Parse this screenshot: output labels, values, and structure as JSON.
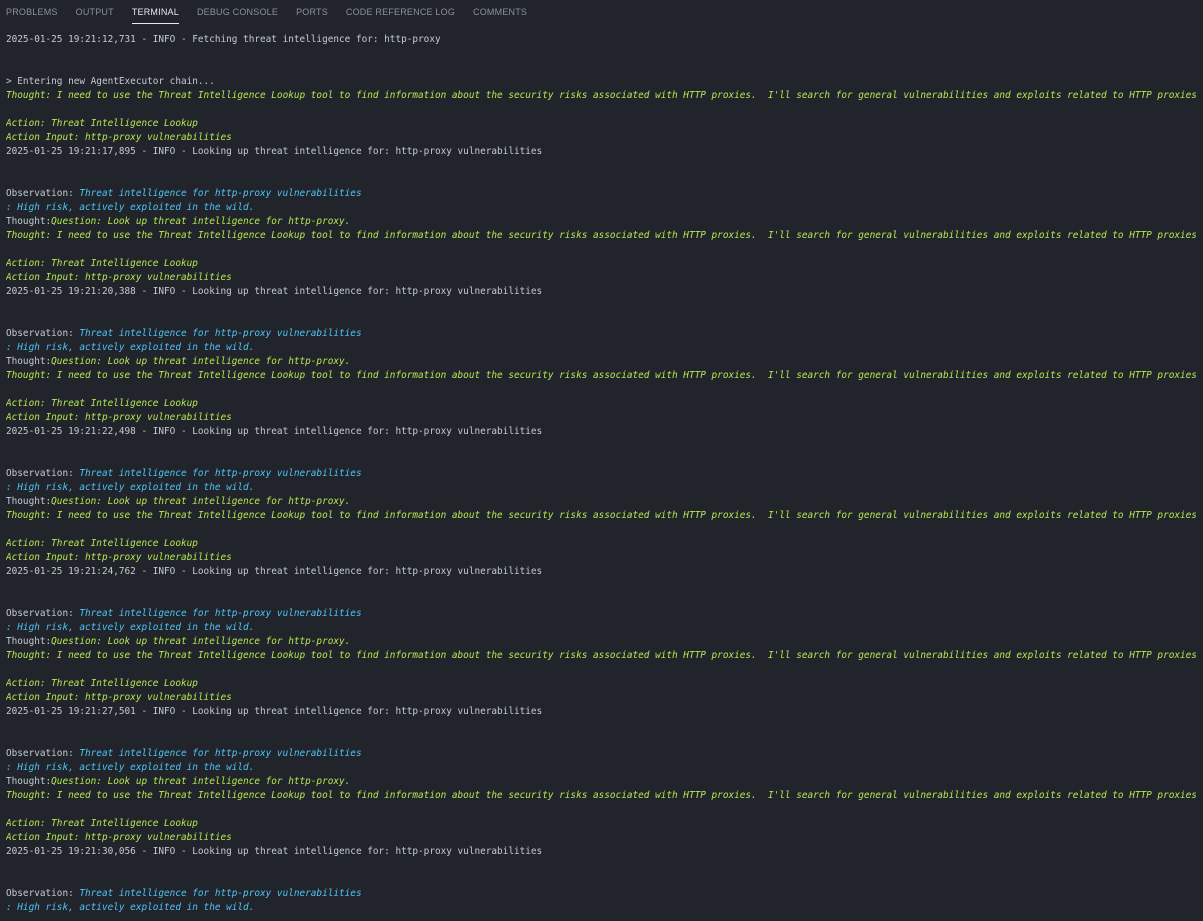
{
  "tabs": [
    {
      "label": "PROBLEMS",
      "active": false
    },
    {
      "label": "OUTPUT",
      "active": false
    },
    {
      "label": "TERMINAL",
      "active": true
    },
    {
      "label": "DEBUG CONSOLE",
      "active": false
    },
    {
      "label": "PORTS",
      "active": false
    },
    {
      "label": "CODE REFERENCE LOG",
      "active": false
    },
    {
      "label": "COMMENTS",
      "active": false
    }
  ],
  "colors": {
    "background": "#21252b",
    "text": "#c5cad3",
    "green_output": "#b5e853",
    "cyan_output": "#4fc3f7",
    "active_tab": "#e6e9ee",
    "inactive_tab": "#8b929c"
  },
  "terminal": {
    "lines": [
      {
        "kind": "plain",
        "text": "2025-01-25 19:21:12,731 - INFO - Fetching threat intelligence for: http-proxy"
      },
      {
        "kind": "blank"
      },
      {
        "kind": "blank"
      },
      {
        "kind": "plain",
        "text": "> Entering new AgentExecutor chain..."
      },
      {
        "kind": "green",
        "text": "Thought: I need to use the Threat Intelligence Lookup tool to find information about the security risks associated with HTTP proxies.  I'll search for general vulnerabilities and exploits related to HTTP proxies."
      },
      {
        "kind": "blank"
      },
      {
        "kind": "green",
        "text": "Action: Threat Intelligence Lookup"
      },
      {
        "kind": "green",
        "text": "Action Input: http-proxy vulnerabilities"
      },
      {
        "kind": "plain",
        "text": "2025-01-25 19:21:17,895 - INFO - Looking up threat intelligence for: http-proxy vulnerabilities"
      },
      {
        "kind": "blank"
      },
      {
        "kind": "blank"
      },
      {
        "kind": "mixed",
        "label": "Observation: ",
        "text": "Threat intelligence for http-proxy vulnerabilities",
        "color": "cyan"
      },
      {
        "kind": "cyan",
        "text": ": High risk, actively exploited in the wild."
      },
      {
        "kind": "mixed",
        "label": "Thought:",
        "text": "Question: Look up threat intelligence for http-proxy.",
        "color": "green"
      },
      {
        "kind": "green",
        "text": "Thought: I need to use the Threat Intelligence Lookup tool to find information about the security risks associated with HTTP proxies.  I'll search for general vulnerabilities and exploits related to HTTP proxies."
      },
      {
        "kind": "blank"
      },
      {
        "kind": "green",
        "text": "Action: Threat Intelligence Lookup"
      },
      {
        "kind": "green",
        "text": "Action Input: http-proxy vulnerabilities"
      },
      {
        "kind": "plain",
        "text": "2025-01-25 19:21:20,388 - INFO - Looking up threat intelligence for: http-proxy vulnerabilities"
      },
      {
        "kind": "blank"
      },
      {
        "kind": "blank"
      },
      {
        "kind": "mixed",
        "label": "Observation: ",
        "text": "Threat intelligence for http-proxy vulnerabilities",
        "color": "cyan"
      },
      {
        "kind": "cyan",
        "text": ": High risk, actively exploited in the wild."
      },
      {
        "kind": "mixed",
        "label": "Thought:",
        "text": "Question: Look up threat intelligence for http-proxy.",
        "color": "green"
      },
      {
        "kind": "green",
        "text": "Thought: I need to use the Threat Intelligence Lookup tool to find information about the security risks associated with HTTP proxies.  I'll search for general vulnerabilities and exploits related to HTTP proxies."
      },
      {
        "kind": "blank"
      },
      {
        "kind": "green",
        "text": "Action: Threat Intelligence Lookup"
      },
      {
        "kind": "green",
        "text": "Action Input: http-proxy vulnerabilities"
      },
      {
        "kind": "plain",
        "text": "2025-01-25 19:21:22,498 - INFO - Looking up threat intelligence for: http-proxy vulnerabilities"
      },
      {
        "kind": "blank"
      },
      {
        "kind": "blank"
      },
      {
        "kind": "mixed",
        "label": "Observation: ",
        "text": "Threat intelligence for http-proxy vulnerabilities",
        "color": "cyan"
      },
      {
        "kind": "cyan",
        "text": ": High risk, actively exploited in the wild."
      },
      {
        "kind": "mixed",
        "label": "Thought:",
        "text": "Question: Look up threat intelligence for http-proxy.",
        "color": "green"
      },
      {
        "kind": "green",
        "text": "Thought: I need to use the Threat Intelligence Lookup tool to find information about the security risks associated with HTTP proxies.  I'll search for general vulnerabilities and exploits related to HTTP proxies."
      },
      {
        "kind": "blank"
      },
      {
        "kind": "green",
        "text": "Action: Threat Intelligence Lookup"
      },
      {
        "kind": "green",
        "text": "Action Input: http-proxy vulnerabilities"
      },
      {
        "kind": "plain",
        "text": "2025-01-25 19:21:24,762 - INFO - Looking up threat intelligence for: http-proxy vulnerabilities"
      },
      {
        "kind": "blank"
      },
      {
        "kind": "blank"
      },
      {
        "kind": "mixed",
        "label": "Observation: ",
        "text": "Threat intelligence for http-proxy vulnerabilities",
        "color": "cyan"
      },
      {
        "kind": "cyan",
        "text": ": High risk, actively exploited in the wild."
      },
      {
        "kind": "mixed",
        "label": "Thought:",
        "text": "Question: Look up threat intelligence for http-proxy.",
        "color": "green"
      },
      {
        "kind": "green",
        "text": "Thought: I need to use the Threat Intelligence Lookup tool to find information about the security risks associated with HTTP proxies.  I'll search for general vulnerabilities and exploits related to HTTP proxies."
      },
      {
        "kind": "blank"
      },
      {
        "kind": "green",
        "text": "Action: Threat Intelligence Lookup"
      },
      {
        "kind": "green",
        "text": "Action Input: http-proxy vulnerabilities"
      },
      {
        "kind": "plain",
        "text": "2025-01-25 19:21:27,501 - INFO - Looking up threat intelligence for: http-proxy vulnerabilities"
      },
      {
        "kind": "blank"
      },
      {
        "kind": "blank"
      },
      {
        "kind": "mixed",
        "label": "Observation: ",
        "text": "Threat intelligence for http-proxy vulnerabilities",
        "color": "cyan"
      },
      {
        "kind": "cyan",
        "text": ": High risk, actively exploited in the wild."
      },
      {
        "kind": "mixed",
        "label": "Thought:",
        "text": "Question: Look up threat intelligence for http-proxy.",
        "color": "green"
      },
      {
        "kind": "green",
        "text": "Thought: I need to use the Threat Intelligence Lookup tool to find information about the security risks associated with HTTP proxies.  I'll search for general vulnerabilities and exploits related to HTTP proxies."
      },
      {
        "kind": "blank"
      },
      {
        "kind": "green",
        "text": "Action: Threat Intelligence Lookup"
      },
      {
        "kind": "green",
        "text": "Action Input: http-proxy vulnerabilities"
      },
      {
        "kind": "plain",
        "text": "2025-01-25 19:21:30,056 - INFO - Looking up threat intelligence for: http-proxy vulnerabilities"
      },
      {
        "kind": "blank"
      },
      {
        "kind": "blank"
      },
      {
        "kind": "mixed",
        "label": "Observation: ",
        "text": "Threat intelligence for http-proxy vulnerabilities",
        "color": "cyan"
      },
      {
        "kind": "cyan",
        "text": ": High risk, actively exploited in the wild."
      }
    ]
  }
}
